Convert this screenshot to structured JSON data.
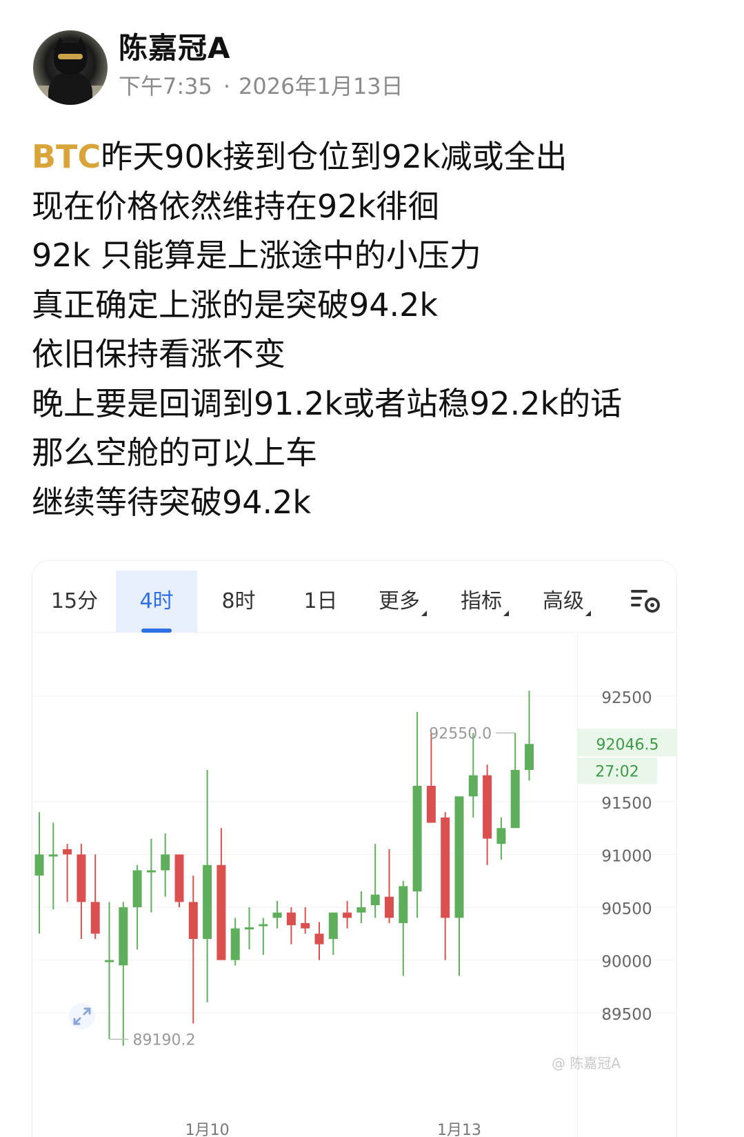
{
  "author": {
    "name": "陈嘉冠A",
    "time": "下午7:35",
    "separator": "·",
    "date": "2026年1月13日"
  },
  "post": {
    "ticker": "BTC",
    "line1_rest": "昨天90k接到仓位到92k减或全出",
    "lines": [
      "现在价格依然维持在92k徘徊",
      "92k 只能算是上涨途中的小压力",
      "真正确定上涨的是突破94.2k",
      "依旧保持看涨不变",
      "晚上要是回调到91.2k或者站稳92.2k的话",
      "那么空舱的可以上车",
      "继续等待突破94.2k"
    ]
  },
  "chart_tabs": [
    {
      "label": "15分",
      "active": false
    },
    {
      "label": "4时",
      "active": true
    },
    {
      "label": "8时",
      "active": false
    },
    {
      "label": "1日",
      "active": false
    },
    {
      "label": "更多",
      "active": false,
      "dropdown": true
    },
    {
      "label": "指标",
      "active": false,
      "dropdown": true
    },
    {
      "label": "高级",
      "active": false,
      "dropdown": true
    }
  ],
  "icons": {
    "settings": "chart-settings-icon",
    "expand": "expand-arrows-icon"
  },
  "colors": {
    "up": "#5fae5c",
    "down": "#d9504f",
    "active_tab": "#2f6fe6",
    "ticker": "#d9a53a",
    "current_price_bg": "#e9f6ea",
    "current_price_text": "#3e9a44"
  },
  "chart_data": {
    "type": "candlestick",
    "interval": "4时",
    "y_ticks": [
      92500,
      91500,
      91000,
      90500,
      90000,
      89500
    ],
    "ylim": [
      89050,
      93100
    ],
    "x_tick_labels": [
      {
        "label": "1月10",
        "index": 12
      },
      {
        "label": "1月13",
        "index": 30
      }
    ],
    "current_price": "92046.5",
    "countdown": "27:02",
    "max_label": "92550.0",
    "max_index": 34,
    "min_label": "89190.2",
    "min_index": 5,
    "candles": [
      {
        "o": 90800,
        "h": 91400,
        "l": 90250,
        "c": 91000
      },
      {
        "o": 91000,
        "h": 91300,
        "l": 90480,
        "c": 91000
      },
      {
        "o": 91050,
        "h": 91100,
        "l": 90550,
        "c": 91000
      },
      {
        "o": 91000,
        "h": 91100,
        "l": 90200,
        "c": 90550
      },
      {
        "o": 90550,
        "h": 91000,
        "l": 90200,
        "c": 90250
      },
      {
        "o": 90000,
        "h": 90550,
        "l": 89250,
        "c": 90000
      },
      {
        "o": 89950,
        "h": 90550,
        "l": 89190,
        "c": 90500
      },
      {
        "o": 90500,
        "h": 90900,
        "l": 90100,
        "c": 90850
      },
      {
        "o": 90850,
        "h": 91150,
        "l": 90450,
        "c": 90850
      },
      {
        "o": 90850,
        "h": 91200,
        "l": 90600,
        "c": 91000
      },
      {
        "o": 91000,
        "h": 91000,
        "l": 90500,
        "c": 90550
      },
      {
        "o": 90550,
        "h": 90800,
        "l": 89400,
        "c": 90200
      },
      {
        "o": 90200,
        "h": 91800,
        "l": 89600,
        "c": 90900
      },
      {
        "o": 90900,
        "h": 91250,
        "l": 90050,
        "c": 90000
      },
      {
        "o": 90000,
        "h": 90400,
        "l": 89950,
        "c": 90300
      },
      {
        "o": 90300,
        "h": 90500,
        "l": 90100,
        "c": 90310
      },
      {
        "o": 90330,
        "h": 90400,
        "l": 90050,
        "c": 90340
      },
      {
        "o": 90400,
        "h": 90560,
        "l": 90300,
        "c": 90450
      },
      {
        "o": 90450,
        "h": 90500,
        "l": 90150,
        "c": 90330
      },
      {
        "o": 90350,
        "h": 90500,
        "l": 90250,
        "c": 90300
      },
      {
        "o": 90250,
        "h": 90360,
        "l": 90000,
        "c": 90150
      },
      {
        "o": 90200,
        "h": 90450,
        "l": 90050,
        "c": 90450
      },
      {
        "o": 90450,
        "h": 90560,
        "l": 90300,
        "c": 90400
      },
      {
        "o": 90450,
        "h": 90650,
        "l": 90350,
        "c": 90500
      },
      {
        "o": 90520,
        "h": 91100,
        "l": 90400,
        "c": 90620
      },
      {
        "o": 90600,
        "h": 91050,
        "l": 90350,
        "c": 90400
      },
      {
        "o": 90350,
        "h": 90750,
        "l": 89850,
        "c": 90700
      },
      {
        "o": 90650,
        "h": 92350,
        "l": 90400,
        "c": 91650
      },
      {
        "o": 91650,
        "h": 92150,
        "l": 91400,
        "c": 91300
      },
      {
        "o": 91350,
        "h": 91400,
        "l": 90000,
        "c": 90400
      },
      {
        "o": 90400,
        "h": 91500,
        "l": 89850,
        "c": 91550
      },
      {
        "o": 91550,
        "h": 92150,
        "l": 91350,
        "c": 91750
      },
      {
        "o": 91750,
        "h": 91850,
        "l": 90900,
        "c": 91150
      },
      {
        "o": 91100,
        "h": 91350,
        "l": 90950,
        "c": 91250
      },
      {
        "o": 91250,
        "h": 92150,
        "l": 91300,
        "c": 91800
      },
      {
        "o": 91800,
        "h": 92550,
        "l": 91700,
        "c": 92046.5
      }
    ]
  },
  "watermark": "@ 陈嘉冠A"
}
